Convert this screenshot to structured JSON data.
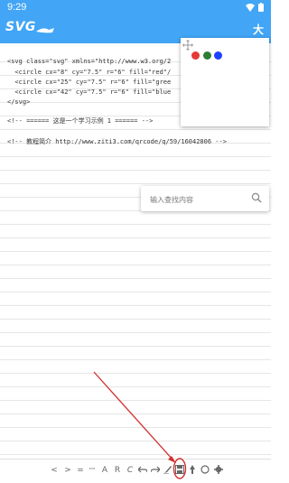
{
  "status_bar": {
    "time": "9:29"
  },
  "app_bar": {
    "logo_text": "SVG",
    "font_size_button": "大"
  },
  "editor": {
    "lines": [
      "<svg class=\"svg\" xmlns=\"http://www.w3.org/2",
      "  <circle cx=\"8\" cy=\"7.5\" r=\"6\" fill=\"red\"/",
      "  <circle cx=\"25\" cy=\"7.5\" r=\"6\" fill=\"gree",
      "  <circle cx=\"42\" cy=\"7.5\" r=\"6\" fill=\"blue",
      "</svg>",
      "",
      "<!-- ====== 这是一个学习示例 1 ====== -->",
      "",
      "<!-- 教程简介 http://www.ziti3.com/qrcode/q/59/16042806 -->"
    ]
  },
  "preview": {
    "circles": [
      {
        "color": "#e53935"
      },
      {
        "color": "#2e7d32"
      },
      {
        "color": "#1e40ff"
      }
    ]
  },
  "search": {
    "placeholder": "输入查找内容"
  },
  "toolbar": {
    "items": [
      "<",
      ">",
      "=",
      "\"\"",
      "A",
      "R",
      "C",
      "undo",
      "redo",
      "brush",
      "save",
      "run",
      "circle",
      "settings"
    ],
    "lt": "<",
    "gt": ">",
    "eq": "=",
    "quote": "\"\"",
    "a": "A",
    "r": "R",
    "c": "C"
  },
  "colors": {
    "accent": "#42a5f5",
    "annotation": "#d32f2f"
  }
}
